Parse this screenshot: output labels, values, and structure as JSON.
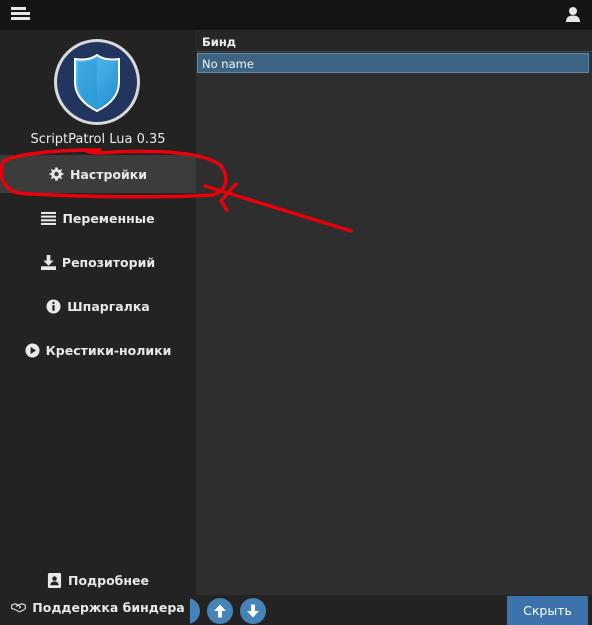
{
  "window": {
    "menu_icon": "hamburger-icon",
    "user_icon": "user-icon"
  },
  "sidebar": {
    "app_title": "ScriptPatrol Lua 0.35",
    "logo_icon": "shield-icon",
    "items": [
      {
        "label": "Настройки",
        "icon": "gear-icon",
        "active": true
      },
      {
        "label": "Переменные",
        "icon": "list-icon",
        "active": false
      },
      {
        "label": "Репозиторий",
        "icon": "download-icon",
        "active": false
      },
      {
        "label": "Шпаргалка",
        "icon": "info-icon",
        "active": false
      },
      {
        "label": "Крестики-нолики",
        "icon": "play-icon",
        "active": false
      }
    ],
    "footer": [
      {
        "label": "Подробнее",
        "icon": "contact-icon"
      },
      {
        "label": "Поддержка биндера",
        "icon": "handshake-icon"
      }
    ]
  },
  "table": {
    "header": "Бинд",
    "rows": [
      "No name"
    ]
  },
  "bottom": {
    "hide_label": "Скрыть",
    "up_icon": "arrow-up-icon",
    "down_icon": "arrow-down-icon"
  },
  "colors": {
    "accent": "#3d73ad",
    "selection": "#3d6583",
    "sidebar": "#232323",
    "annotation": "#e8000b"
  }
}
